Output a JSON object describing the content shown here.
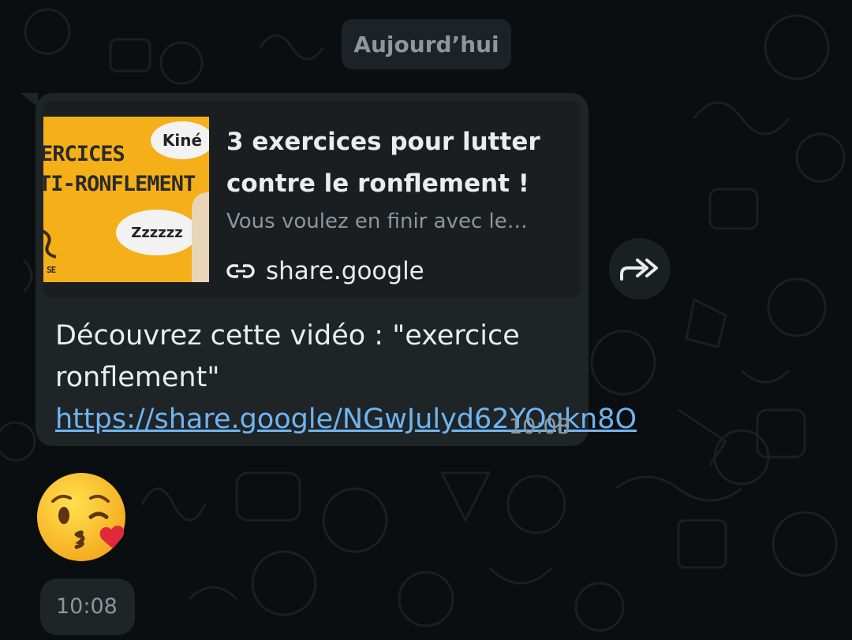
{
  "date_chip": "Aujourd’hui",
  "message": {
    "link_preview": {
      "title": "3 exercices pour lutter contre le ronflement !",
      "description": "Vous voulez en finir avec le…",
      "domain": "share.google",
      "thumbnail": {
        "line1": "ERCICES",
        "line2": "TI-RONFLEMENT",
        "badge": "Kiné",
        "bubble": "Zzzzzz",
        "corner": "SE"
      }
    },
    "text_prefix": "Découvrez cette vidéo : \"exercice ronflement\" ",
    "link": "https://share.google/NGwJulyd62YOqkn8O",
    "time": "10:08"
  },
  "emoji_message": {
    "emoji": "face-blowing-a-kiss",
    "time": "10:08"
  },
  "icons": {
    "link": "link-icon",
    "forward": "forward-icon"
  },
  "colors": {
    "background": "#0b0e10",
    "bubble": "#1f2427",
    "link": "#6fb4f0",
    "thumbnail": "#f5b019"
  }
}
